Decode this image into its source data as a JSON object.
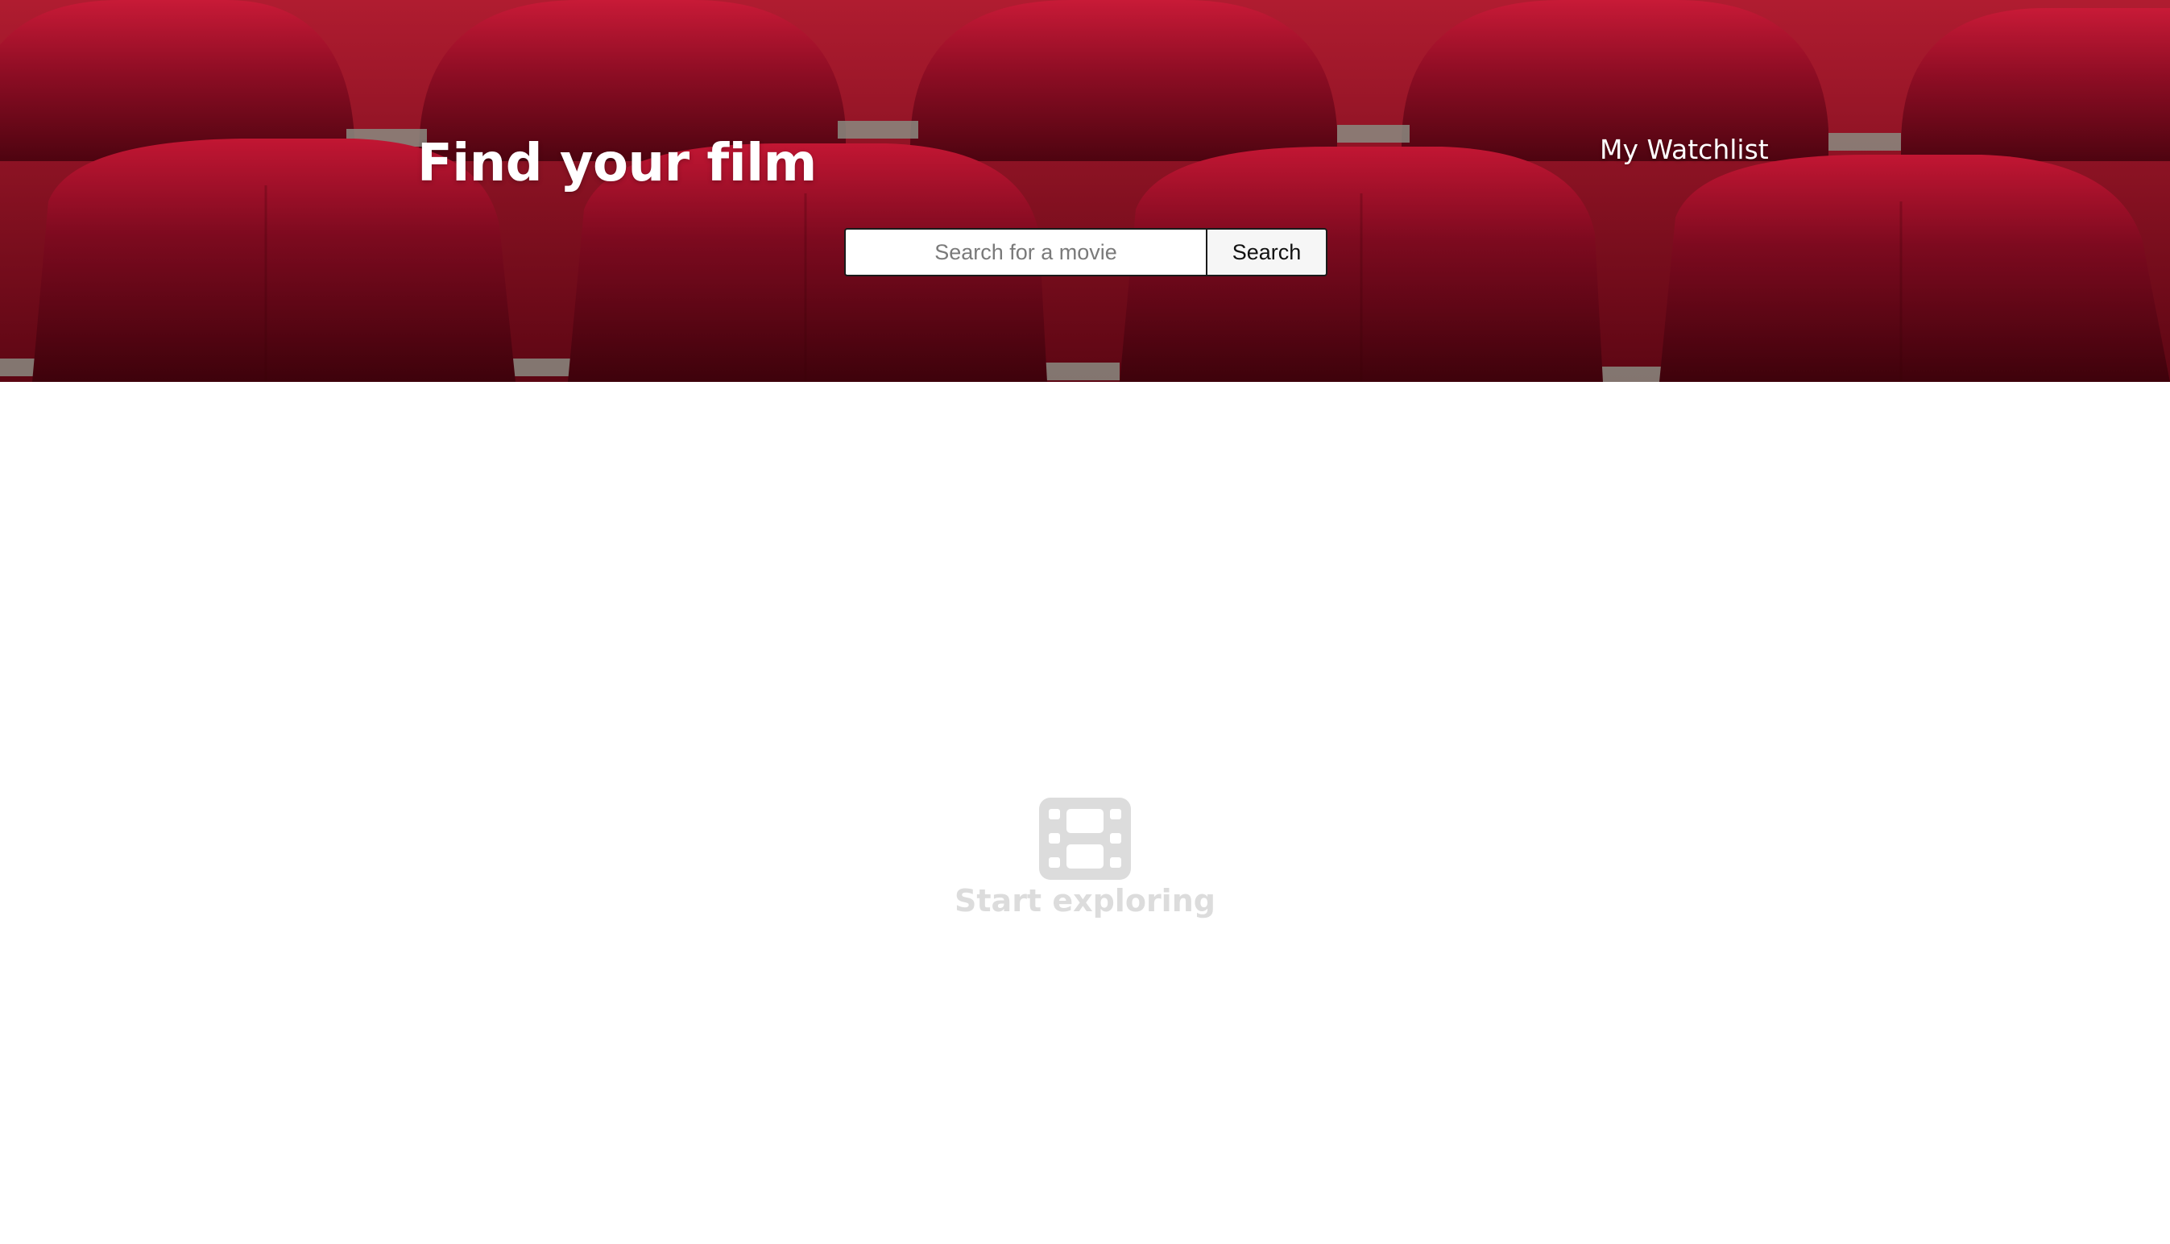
{
  "header": {
    "title": "Find your film",
    "nav": {
      "watchlist_label": "My Watchlist"
    }
  },
  "search": {
    "placeholder": "Search for a movie",
    "value": "",
    "button_label": "Search"
  },
  "empty_state": {
    "icon": "film-icon",
    "message": "Start exploring"
  },
  "colors": {
    "hero_background": "#7a0a1c",
    "seat_red": "#a0122b",
    "empty_text": "#dcdcdc"
  }
}
